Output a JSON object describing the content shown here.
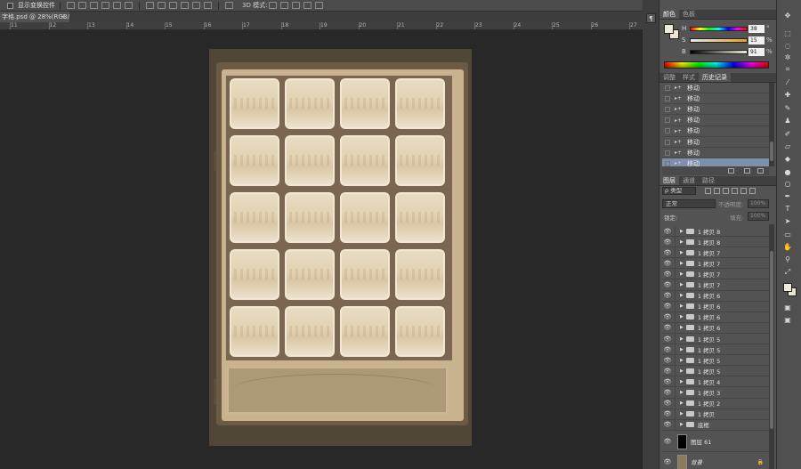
{
  "options_bar": {
    "show_transform_controls": "显示变换控件",
    "mode_3d": "3D 模式:"
  },
  "document_tab": {
    "title": "字格.psd @ 28%(RGB/8)",
    "close": "×"
  },
  "ruler_ticks": [
    "11",
    "12",
    "13",
    "14",
    "15",
    "16",
    "17",
    "18",
    "19",
    "20",
    "21",
    "22",
    "23",
    "24",
    "25",
    "26",
    "27"
  ],
  "color_panel": {
    "tabs": [
      "颜色",
      "色板"
    ],
    "fg_color": "#f1ebdd",
    "bg_color": "#ece5d3",
    "sliders": [
      {
        "label": "H",
        "value": "38",
        "unit": "°"
      },
      {
        "label": "S",
        "value": "15",
        "unit": "%"
      },
      {
        "label": "B",
        "value": "91",
        "unit": "%"
      }
    ]
  },
  "history_panel": {
    "tabs": [
      "调整",
      "样式",
      "历史记录"
    ],
    "items": [
      "移动",
      "移动",
      "移动",
      "移动",
      "移动",
      "移动",
      "移动",
      "移动"
    ],
    "selected_index": 7
  },
  "layers_panel": {
    "tabs": [
      "图层",
      "通道",
      "路径"
    ],
    "filter_label": "ρ 类型",
    "blend_mode": "正常",
    "opacity_label": "不透明度:",
    "opacity_value": "100%",
    "lock_label": "锁定:",
    "fill_label": "填充:",
    "fill_value": "100%",
    "groups": [
      "1 拷贝 8",
      "1 拷贝 8",
      "1 拷贝 7",
      "1 拷贝 7",
      "1 拷贝 7",
      "1 拷贝 7",
      "1 拷贝 6",
      "1 拷贝 6",
      "1 拷贝 6",
      "1 拷贝 6",
      "1 拷贝 5",
      "1 拷贝 5",
      "1 拷贝 5",
      "1 拷贝 5",
      "1 拷贝 4",
      "1 拷贝 3",
      "1 拷贝 2",
      "1 拷贝",
      "底框"
    ],
    "layer_61": "图层 61",
    "background": "背景",
    "eye_glyph": "👁"
  },
  "grid": {
    "rows": 5,
    "cols": 4
  }
}
